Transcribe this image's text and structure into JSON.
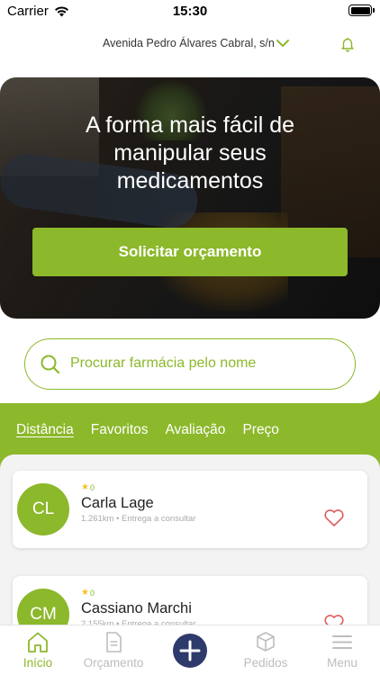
{
  "status_bar": {
    "carrier": "Carrier",
    "time": "15:30"
  },
  "header": {
    "address": "Avenida Pedro Álvares Cabral, s/n",
    "chevron_icon": "chevron-down-icon",
    "bell_icon": "bell-icon"
  },
  "hero": {
    "title": "A forma mais fácil de manipular seus medicamentos",
    "button_label": "Solicitar orçamento"
  },
  "search": {
    "placeholder": "Procurar farmácia pelo nome",
    "icon": "search-icon"
  },
  "filters": {
    "tabs": [
      {
        "label": "Distância",
        "active": true
      },
      {
        "label": "Favoritos"
      },
      {
        "label": "Avaliação"
      },
      {
        "label": "Preço"
      }
    ]
  },
  "pharmacies": [
    {
      "initials": "CL",
      "rating": "0",
      "name": "Carla Lage",
      "meta": "1.261km • Entrega a consultar"
    },
    {
      "initials": "CM",
      "rating": "0",
      "name": "Cassiano Marchi",
      "meta": "2.155km • Entrega a consultar"
    }
  ],
  "tabbar": {
    "items": [
      {
        "label": "Início",
        "icon": "home-icon",
        "active": true
      },
      {
        "label": "Orçamento",
        "icon": "document-icon"
      },
      {
        "label": "",
        "icon": "plus-icon"
      },
      {
        "label": "Pedidos",
        "icon": "box-icon"
      },
      {
        "label": "Menu",
        "icon": "hamburger-icon"
      }
    ]
  },
  "colors": {
    "accent": "#8cb82b",
    "fab": "#2e3a6b",
    "heart": "#e05a5a",
    "star": "#f0c419"
  }
}
